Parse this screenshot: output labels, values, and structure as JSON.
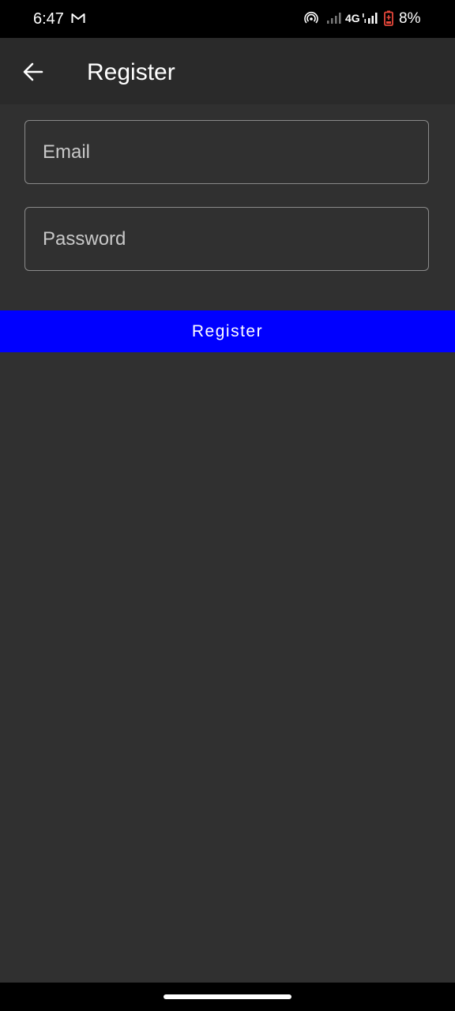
{
  "status_bar": {
    "time": "6:47",
    "network": "4G",
    "battery": "8%",
    "icons": [
      "gmail-icon",
      "hotspot-icon",
      "signal-icon",
      "signal-icon",
      "battery-low-icon"
    ],
    "battery_color": "#e8483b"
  },
  "app_bar": {
    "title": "Register",
    "back_icon": "arrow-left-icon"
  },
  "form": {
    "email_placeholder": "Email",
    "email_value": "",
    "password_placeholder": "Password",
    "password_value": "",
    "submit_label": "Register"
  },
  "colors": {
    "background": "#303030",
    "app_bar": "#2a2a2a",
    "button": "#0000ff"
  }
}
